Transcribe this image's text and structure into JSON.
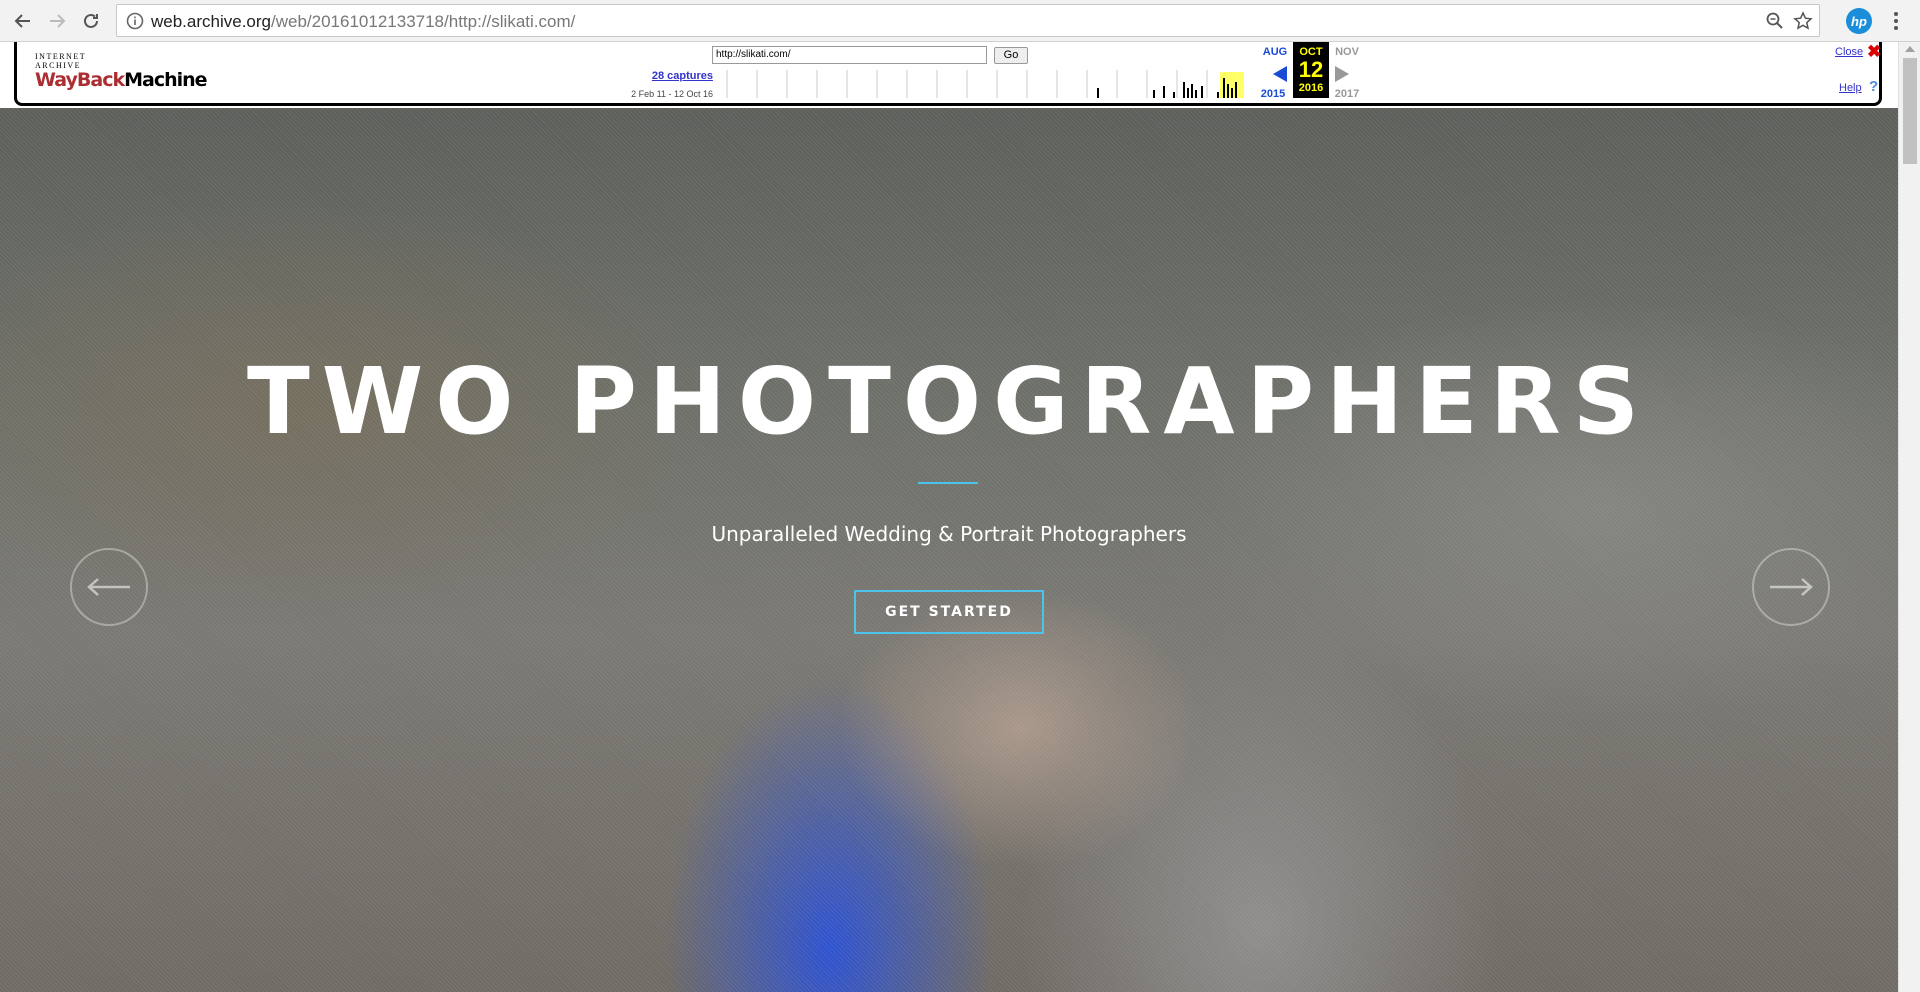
{
  "browser": {
    "url_host": "web.archive.org",
    "url_path": "/web/20161012133718/http://slikati.com/",
    "extension_label": "hp"
  },
  "wayback": {
    "logo_top": "INTERNET ARCHIVE",
    "logo_wayback": "WayBack",
    "logo_machine": "Machine",
    "url_value": "http://slikati.com/",
    "go_label": "Go",
    "captures": "28 captures",
    "range": "2 Feb 11 - 12 Oct 16",
    "prev_month": "AUG",
    "prev_year": "2015",
    "cur_month": "OCT",
    "cur_day": "12",
    "cur_year": "2016",
    "next_month": "NOV",
    "next_year": "2017",
    "close_label": "Close",
    "help_label": "Help"
  },
  "hero": {
    "title": "TWO PHOTOGRAPHERS",
    "subtitle": "Unparalleled Wedding & Portrait Photographers",
    "cta": "GET STARTED"
  },
  "colors": {
    "accent": "#4cc3ea",
    "wayback_red": "#ab2e33",
    "link_blue": "#3333cc"
  }
}
